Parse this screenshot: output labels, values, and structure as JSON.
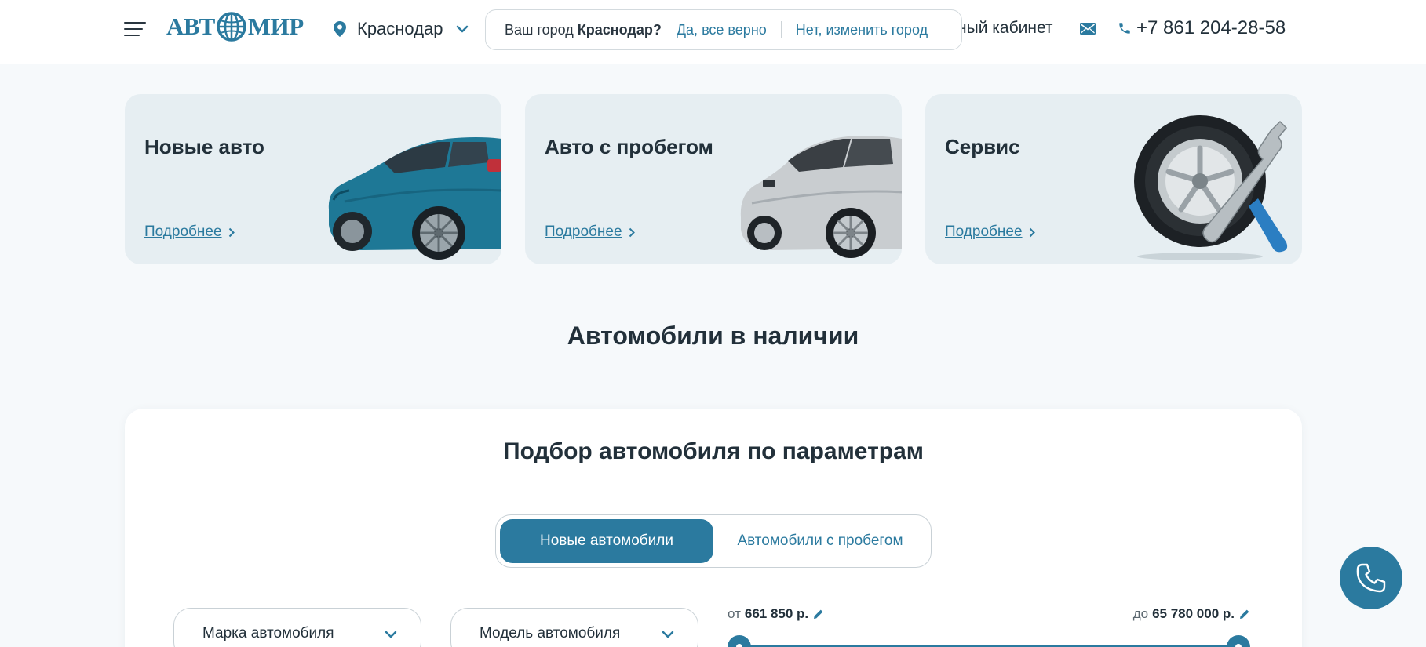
{
  "header": {
    "logo": {
      "left": "АВТ",
      "right": "МИР"
    },
    "city": "Краснодар",
    "city_prompt": {
      "question": "Ваш город",
      "city": "Краснодар?",
      "confirm": "Да, все верно",
      "change": "Нет, изменить город"
    },
    "cabinet": "ный кабинет",
    "phone": "+7 861 204-28-58"
  },
  "cards": [
    {
      "title": "Новые авто",
      "link": "Подробнее"
    },
    {
      "title": "Авто с пробегом",
      "link": "Подробнее"
    },
    {
      "title": "Сервис",
      "link": "Подробнее"
    }
  ],
  "section_title": "Автомобили в наличии",
  "filter": {
    "title": "Подбор автомобиля по параметрам",
    "tabs": [
      "Новые автомобили",
      "Автомобили с пробегом"
    ],
    "active_tab": 0,
    "brand_select": "Марка автомобиля",
    "model_select": "Модель автомобиля",
    "price": {
      "from_label": "от",
      "from_value": "661 850 р.",
      "to_label": "до",
      "to_value": "65 780 000 р."
    }
  },
  "colors": {
    "accent": "#2b7a9f",
    "card_bg": "#e6eef2",
    "page_bg": "#f6f9fb"
  },
  "icons": [
    "menu-icon",
    "globe-icon",
    "location-pin-icon",
    "chevron-down-icon",
    "mail-icon",
    "phone-icon",
    "chevron-right-icon",
    "pencil-icon",
    "callback-phone-icon"
  ]
}
